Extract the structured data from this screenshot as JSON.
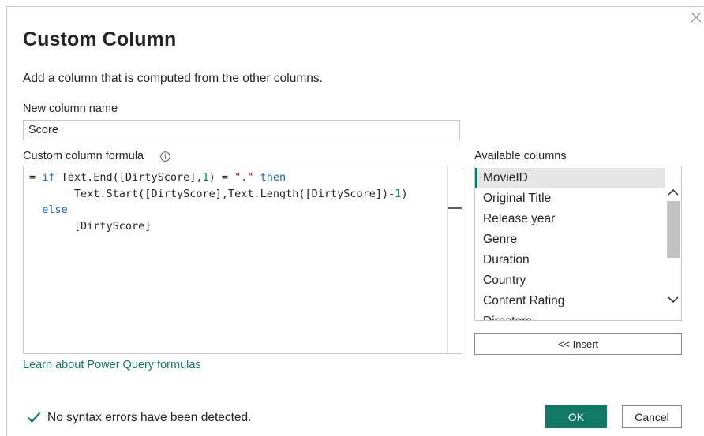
{
  "dialog": {
    "title": "Custom Column",
    "description": "Add a column that is computed from the other columns.",
    "close_icon": "close-icon"
  },
  "new_column": {
    "label": "New column name",
    "value": "Score"
  },
  "formula": {
    "label": "Custom column formula",
    "info_icon": "info-icon",
    "line1": {
      "prefix": "= ",
      "kw_if": "if",
      "part1": " Text.End([DirtyScore],",
      "num1": "1",
      "part2": ") = ",
      "str1": "\".\"",
      "space": " ",
      "kw_then": "then"
    },
    "line2": {
      "indent": "       ",
      "part1": "Text.Start([DirtyScore],Text.Length([DirtyScore])-",
      "num1": "1",
      "part2": ")"
    },
    "line3": {
      "indent": "  ",
      "kw_else": "else"
    },
    "line4": {
      "indent": "       ",
      "part1": "[DirtyScore]"
    }
  },
  "available_columns": {
    "label": "Available columns",
    "items": [
      "MovieID",
      "Original Title",
      "Release year",
      "Genre",
      "Duration",
      "Country",
      "Content Rating",
      "Directors"
    ],
    "selected": "MovieID",
    "insert_label": "<< Insert"
  },
  "learn_link": "Learn about Power Query formulas",
  "status": {
    "icon": "checkmark-icon",
    "text": "No syntax errors have been detected."
  },
  "buttons": {
    "ok": "OK",
    "cancel": "Cancel"
  },
  "colors": {
    "accent": "#117865",
    "keyword": "#0e66c0",
    "string": "#a31515",
    "number": "#098658"
  }
}
